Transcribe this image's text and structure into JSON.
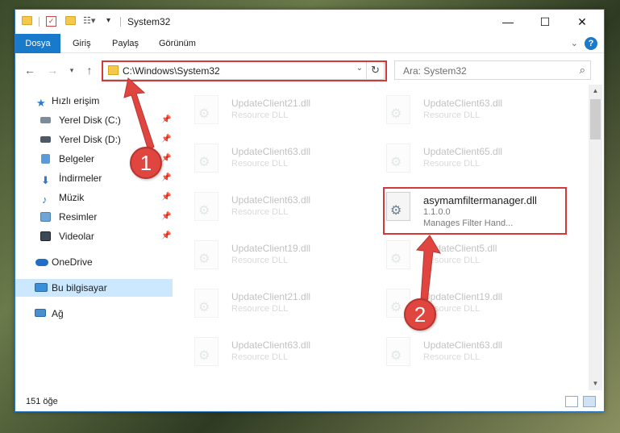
{
  "window": {
    "title": "System32",
    "controls": {
      "minimize": "—",
      "maximize": "☐",
      "close": "✕"
    }
  },
  "ribbon": {
    "tabs": [
      "Dosya",
      "Giriş",
      "Paylaş",
      "Görünüm"
    ],
    "expand_icon": "chevron-down-icon",
    "help_label": "?"
  },
  "navbar": {
    "address": "C:\\Windows\\System32",
    "search_placeholder": "Ara: System32"
  },
  "sidebar": {
    "items": [
      {
        "label": "Hızlı erişim",
        "icon": "star-icon",
        "pinned": false,
        "selected": false
      },
      {
        "label": "Yerel Disk (C:)",
        "icon": "drive-icon",
        "pinned": true,
        "selected": false
      },
      {
        "label": "Yerel Disk (D:)",
        "icon": "drive-icon",
        "pinned": true,
        "selected": false
      },
      {
        "label": "Belgeler",
        "icon": "documents-icon",
        "pinned": true,
        "selected": false
      },
      {
        "label": "İndirmeler",
        "icon": "downloads-icon",
        "pinned": true,
        "selected": false
      },
      {
        "label": "Müzik",
        "icon": "music-icon",
        "pinned": true,
        "selected": false
      },
      {
        "label": "Resimler",
        "icon": "pictures-icon",
        "pinned": true,
        "selected": false
      },
      {
        "label": "Videolar",
        "icon": "videos-icon",
        "pinned": true,
        "selected": false
      },
      {
        "label": "OneDrive",
        "icon": "onedrive-icon",
        "pinned": false,
        "selected": false
      },
      {
        "label": "Bu bilgisayar",
        "icon": "computer-icon",
        "pinned": false,
        "selected": true
      },
      {
        "label": "Ağ",
        "icon": "network-icon",
        "pinned": false,
        "selected": false
      }
    ]
  },
  "files": [
    {
      "name": "UpdateClient21.dll",
      "desc": "Resource DLL"
    },
    {
      "name": "UpdateClient63.dll",
      "desc": "Resource DLL"
    },
    {
      "name": "UpdateClient63.dll",
      "desc": "Resource DLL"
    },
    {
      "name": "UpdateClient65.dll",
      "desc": "Resource DLL"
    },
    {
      "name": "UpdateClient63.dll",
      "desc": "Resource DLL"
    },
    {
      "name": "asymamfiltermanager.dll",
      "version": "1.1.0.0",
      "desc": "Manages Filter Hand..."
    },
    {
      "name": "UpdateClient19.dll",
      "desc": "Resource DLL"
    },
    {
      "name": "UpdateClient5.dll",
      "desc": "Resource DLL"
    },
    {
      "name": "UpdateClient21.dll",
      "desc": "Resource DLL"
    },
    {
      "name": "UpdateClient19.dll",
      "desc": "Resource DLL"
    },
    {
      "name": "UpdateClient63.dll",
      "desc": "Resource DLL"
    },
    {
      "name": "UpdateClient63.dll",
      "desc": "Resource DLL"
    }
  ],
  "status": {
    "item_count": "151 öğe"
  },
  "annotations": {
    "badge1": "1",
    "badge2": "2",
    "color": "#e0463f"
  }
}
